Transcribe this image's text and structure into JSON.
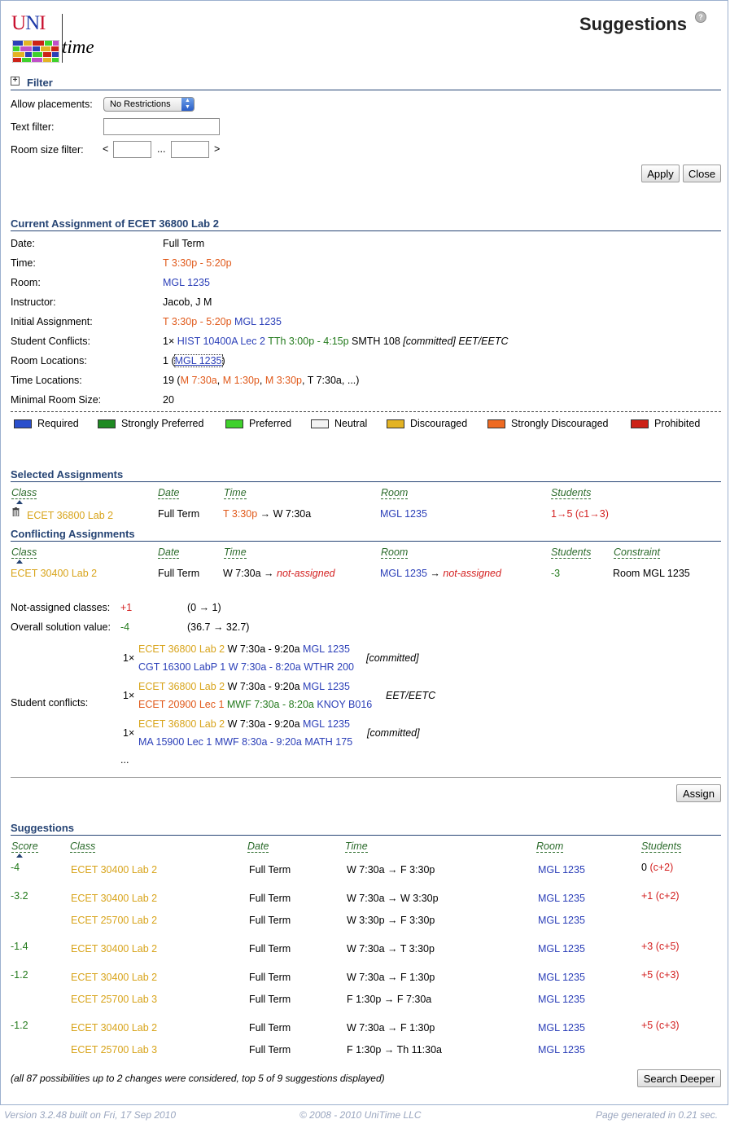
{
  "logo": {
    "u1": "U",
    "u2": "N",
    "u3": "I",
    "time": "time"
  },
  "page_title": "Suggestions",
  "help_icon": "?",
  "filter": {
    "header": "Filter",
    "expand_icon": "+",
    "allow_label": "Allow placements:",
    "allow_value": "No Restrictions",
    "text_label": "Text filter:",
    "text_value": "",
    "size_label": "Room size filter:",
    "lt": "<",
    "dots": "...",
    "gt": ">",
    "apply": "Apply",
    "close": "Close"
  },
  "current": {
    "header": "Current Assignment of ECET 36800 Lab 2",
    "date_label": "Date:",
    "date": "Full Term",
    "time_label": "Time:",
    "time": "T 3:30p - 5:20p",
    "room_label": "Room:",
    "room": "MGL 1235",
    "instructor_label": "Instructor:",
    "instructor": "Jacob, J M",
    "initial_label": "Initial Assignment:",
    "initial_time": "T 3:30p - 5:20p",
    "initial_room": "MGL 1235",
    "sc_label": "Student Conflicts:",
    "sc_count": "1×",
    "sc_class": "HIST 10400A Lec 2",
    "sc_time": "TTh 3:00p - 4:15p",
    "sc_room": "SMTH 108",
    "sc_committed": "[committed]",
    "sc_dept": "EET/EETC",
    "rl_label": "Room Locations:",
    "rl_count": "1",
    "rl_open": "(",
    "rl_room": "MGL 1235",
    "rl_close": ")",
    "tl_label": "Time Locations:",
    "tl_count": "19",
    "tl_open": "(",
    "tl_t1": "M 7:30a",
    "tl_t2": "M 1:30p",
    "tl_t3": "M 3:30p",
    "tl_t4": "T 7:30a",
    "tl_more": "...)",
    "min_label": "Minimal Room Size:",
    "min": "20"
  },
  "legend": [
    {
      "label": "Required",
      "color": "#2a4fcc"
    },
    {
      "label": "Strongly Preferred",
      "color": "#1f8a22"
    },
    {
      "label": "Preferred",
      "color": "#3fd12c"
    },
    {
      "label": "Neutral",
      "color": "#f2f2f2"
    },
    {
      "label": "Discouraged",
      "color": "#e3b324"
    },
    {
      "label": "Strongly Discouraged",
      "color": "#ee6a22"
    },
    {
      "label": "Prohibited",
      "color": "#cc2217"
    }
  ],
  "selected": {
    "header": "Selected Assignments",
    "cols": {
      "class": "Class",
      "date": "Date",
      "time": "Time",
      "room": "Room",
      "students": "Students"
    },
    "row": {
      "class": "ECET 36800 Lab 2",
      "date": "Full Term",
      "time_from": "T 3:30p",
      "arrow": "→",
      "time_to": "W 7:30a",
      "room": "MGL 1235",
      "students": "1→5",
      "students_detail": "(c1→3)"
    }
  },
  "conflicting": {
    "header": "Conflicting Assignments",
    "cols": {
      "class": "Class",
      "date": "Date",
      "time": "Time",
      "room": "Room",
      "students": "Students",
      "constraint": "Constraint"
    },
    "row": {
      "class": "ECET 30400 Lab 2",
      "date": "Full Term",
      "time_from": "W 7:30a",
      "arrow": "→",
      "time_to": "not-assigned",
      "room_from": "MGL 1235",
      "room_to": "not-assigned",
      "students": "-3",
      "constraint": "Room MGL 1235"
    }
  },
  "summary": {
    "na_label": "Not-assigned classes:",
    "na_delta": "+1",
    "na_detail": "(0 → 1)",
    "osv_label": "Overall solution value:",
    "osv_delta": "-4",
    "osv_detail": "(36.7 → 32.7)",
    "sc_label": "Student conflicts:",
    "conflicts": [
      {
        "count": "1×",
        "a_class": "ECET 36800 Lab 2",
        "a_time": "W 7:30a - 9:20a",
        "a_room": "MGL 1235",
        "b_class": "CGT 16300 LabP 1",
        "b_time": "W 7:30a - 8:20a",
        "b_room": "WTHR 200",
        "note": "[committed]"
      },
      {
        "count": "1×",
        "a_class": "ECET 36800 Lab 2",
        "a_time": "W 7:30a - 9:20a",
        "a_room": "MGL 1235",
        "b_class": "ECET 20900 Lec 1",
        "b_time": "MWF 7:30a - 8:20a",
        "b_room": "KNOY B016",
        "note": "EET/EETC"
      },
      {
        "count": "1×",
        "a_class": "ECET 36800 Lab 2",
        "a_time": "W 7:30a - 9:20a",
        "a_room": "MGL 1235",
        "b_class": "MA 15900 Lec 1",
        "b_time": "MWF 8:30a - 9:20a",
        "b_room": "MATH 175",
        "note": "[committed]"
      }
    ],
    "more": "...",
    "assign": "Assign"
  },
  "suggestions": {
    "header": "Suggestions",
    "cols": {
      "score": "Score",
      "class": "Class",
      "date": "Date",
      "time": "Time",
      "room": "Room",
      "students": "Students"
    },
    "groups": [
      {
        "score": "-4",
        "students": "0",
        "students_detail": "(c+2)",
        "rows": [
          {
            "class": "ECET 30400 Lab 2",
            "date": "Full Term",
            "time": "W 7:30a → F 3:30p",
            "room": "MGL 1235"
          }
        ]
      },
      {
        "score": "-3.2",
        "students": "+1",
        "students_detail": "(c+2)",
        "rows": [
          {
            "class": "ECET 30400 Lab 2",
            "date": "Full Term",
            "time": "W 7:30a → W 3:30p",
            "room": "MGL 1235"
          },
          {
            "class": "ECET 25700 Lab 2",
            "date": "Full Term",
            "time": "W 3:30p → F 3:30p",
            "room": "MGL 1235"
          }
        ]
      },
      {
        "score": "-1.4",
        "students": "+3",
        "students_detail": "(c+5)",
        "rows": [
          {
            "class": "ECET 30400 Lab 2",
            "date": "Full Term",
            "time": "W 7:30a → T 3:30p",
            "room": "MGL 1235"
          }
        ]
      },
      {
        "score": "-1.2",
        "students": "+5",
        "students_detail": "(c+3)",
        "rows": [
          {
            "class": "ECET 30400 Lab 2",
            "date": "Full Term",
            "time": "W 7:30a → F 1:30p",
            "room": "MGL 1235"
          },
          {
            "class": "ECET 25700 Lab 3",
            "date": "Full Term",
            "time": "F 1:30p → F 7:30a",
            "room": "MGL 1235"
          }
        ]
      },
      {
        "score": "-1.2",
        "students": "+5",
        "students_detail": "(c+3)",
        "rows": [
          {
            "class": "ECET 30400 Lab 2",
            "date": "Full Term",
            "time": "W 7:30a → F 1:30p",
            "room": "MGL 1235"
          },
          {
            "class": "ECET 25700 Lab 3",
            "date": "Full Term",
            "time": "F 1:30p → Th 11:30a",
            "room": "MGL 1235"
          }
        ]
      }
    ],
    "note": "(all 87 possibilities up to 2 changes were considered, top 5 of 9 suggestions displayed)",
    "search_deeper": "Search Deeper"
  },
  "footer": {
    "version": "Version 3.2.48 built on Fri, 17 Sep 2010",
    "copyright": "© 2008 - 2010 UniTime LLC",
    "generated": "Page generated in 0.21 sec."
  }
}
